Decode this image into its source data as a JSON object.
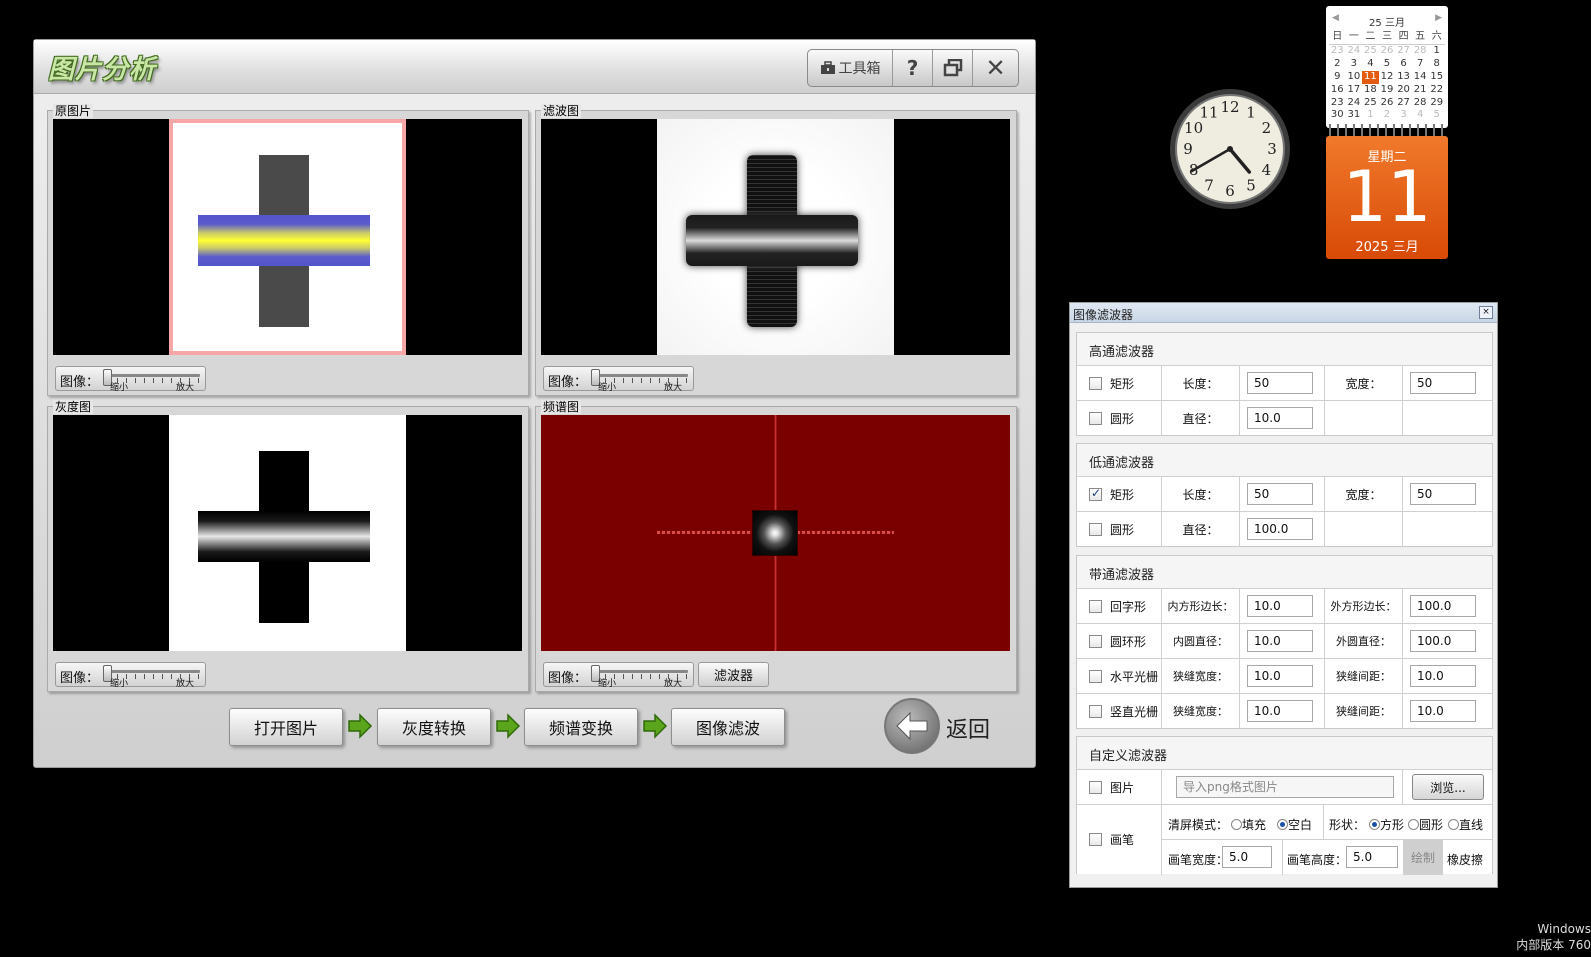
{
  "app": {
    "title": "图片分析",
    "toolbox_label": "工具箱",
    "help_label": "?",
    "restore_label": "🗗",
    "close_label": "✕"
  },
  "panels": {
    "original": {
      "label": "原图片",
      "zoom_label": "图像：",
      "zoom_min": "缩小",
      "zoom_max": "放大"
    },
    "filtered": {
      "label": "滤波图",
      "zoom_label": "图像：",
      "zoom_min": "缩小",
      "zoom_max": "放大"
    },
    "gray": {
      "label": "灰度图",
      "zoom_label": "图像：",
      "zoom_min": "缩小",
      "zoom_max": "放大"
    },
    "spectrum": {
      "label": "频谱图",
      "zoom_label": "图像：",
      "zoom_min": "缩小",
      "zoom_max": "放大",
      "filter_button": "滤波器"
    }
  },
  "workflow": {
    "open_image": "打开图片",
    "gray_convert": "灰度转换",
    "spectrum_convert": "频谱变换",
    "image_filter": "图像滤波",
    "back": "返回"
  },
  "clock": {
    "hour": 4,
    "minute": 40
  },
  "calendar": {
    "month_title": "25 三月",
    "weekday_headers": [
      "日",
      "一",
      "二",
      "三",
      "四",
      "五",
      "六"
    ],
    "weeks": [
      [
        "23",
        "24",
        "25",
        "26",
        "27",
        "28",
        "1"
      ],
      [
        "2",
        "3",
        "4",
        "5",
        "6",
        "7",
        "8"
      ],
      [
        "9",
        "10",
        "11",
        "12",
        "13",
        "14",
        "15"
      ],
      [
        "16",
        "17",
        "18",
        "19",
        "20",
        "21",
        "22"
      ],
      [
        "23",
        "24",
        "25",
        "26",
        "27",
        "28",
        "29"
      ],
      [
        "30",
        "31",
        "1",
        "2",
        "3",
        "4",
        "5"
      ]
    ],
    "weekday": "星期二",
    "day": "11",
    "year_month": "2025 三月",
    "accent": "#e35b10"
  },
  "filter_window": {
    "title": "图像滤波器",
    "close": "×",
    "highpass": {
      "title": "高通滤波器",
      "rect_label": "矩形",
      "length_label": "长度：",
      "length_value": "50",
      "width_label": "宽度：",
      "width_value": "50",
      "circle_label": "圆形",
      "diameter_label": "直径：",
      "diameter_value": "10.0"
    },
    "lowpass": {
      "title": "低通滤波器",
      "rect_label": "矩形",
      "length_label": "长度：",
      "length_value": "50",
      "width_label": "宽度：",
      "width_value": "50",
      "circle_label": "圆形",
      "diameter_label": "直径：",
      "diameter_value": "100.0"
    },
    "bandpass": {
      "title": "带通滤波器",
      "square_ring_label": "回字形",
      "inner_side_label": "内方形边长：",
      "inner_side_value": "10.0",
      "outer_side_label": "外方形边长：",
      "outer_side_value": "100.0",
      "ring_label": "圆环形",
      "inner_diam_label": "内圆直径：",
      "inner_diam_value": "10.0",
      "outer_diam_label": "外圆直径：",
      "outer_diam_value": "100.0",
      "hgrating_label": "水平光栅",
      "h_slit_width_label": "狭缝宽度：",
      "h_slit_width_value": "10.0",
      "h_slit_gap_label": "狭缝间距：",
      "h_slit_gap_value": "10.0",
      "vgrating_label": "竖直光栅",
      "v_slit_width_label": "狭缝宽度：",
      "v_slit_width_value": "10.0",
      "v_slit_gap_label": "狭缝间距：",
      "v_slit_gap_value": "10.0"
    },
    "custom": {
      "title": "自定义滤波器",
      "image_label": "图片",
      "image_placeholder": "导入png格式图片",
      "browse_label": "浏览...",
      "brush_label": "画笔",
      "clear_mode_label": "清屏模式：",
      "fill_label": "填充",
      "blank_label": "空白",
      "shape_label": "形状：",
      "square_label": "方形",
      "circle_label": "圆形",
      "line_label": "直线",
      "brush_width_label": "画笔宽度：",
      "brush_width_value": "5.0",
      "brush_height_label": "画笔高度：",
      "brush_height_value": "5.0",
      "draw_label": "绘制",
      "eraser_label": "橡皮擦"
    }
  },
  "watermark": {
    "line1": "Windows",
    "line2": "内部版本 760"
  }
}
